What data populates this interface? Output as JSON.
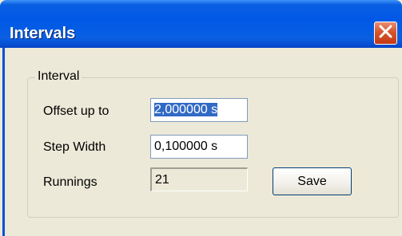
{
  "window": {
    "title": "Intervals",
    "close_icon": "close-icon"
  },
  "group": {
    "legend": "Interval"
  },
  "offset": {
    "label": "Offset up to",
    "value": "2,000000 s"
  },
  "step": {
    "label": "Step Width",
    "value": "0,100000 s"
  },
  "runnings": {
    "label": "Runnings",
    "value": "21"
  },
  "buttons": {
    "save_label": "Save"
  },
  "colors": {
    "titlebar": "#0058e6",
    "dialog_face": "#ece9d8",
    "selection": "#316ac5",
    "close_button": "#d7552e"
  }
}
